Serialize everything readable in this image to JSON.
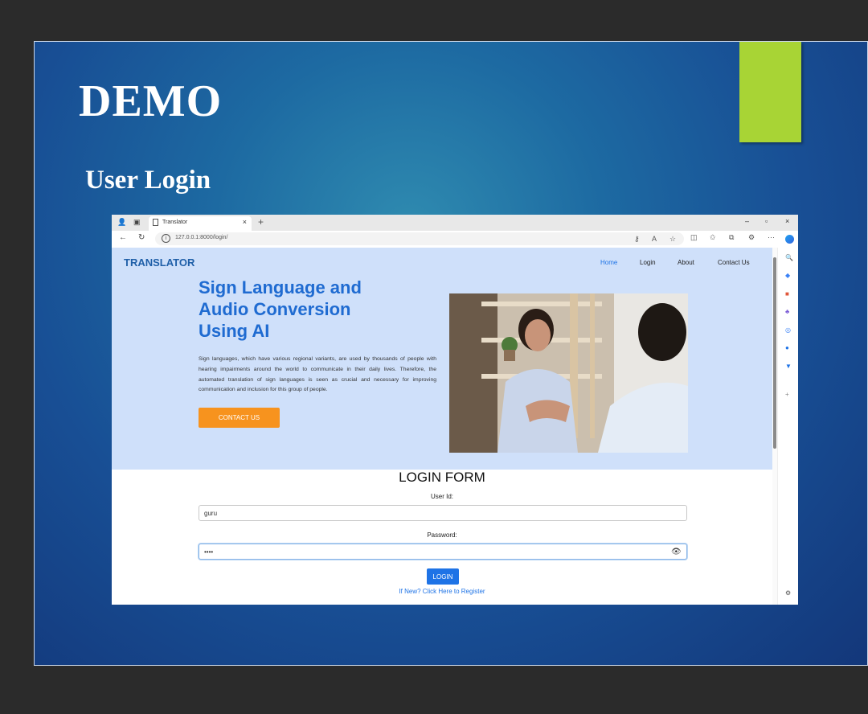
{
  "slide": {
    "title": "DEMO",
    "subtitle": "User Login",
    "accent_color": "#a8d435"
  },
  "browser": {
    "tab_title": "Translator",
    "tab_close": "×",
    "new_tab": "+",
    "url": "127.0.0.1:8000/login/",
    "window_controls": [
      "–",
      "▫",
      "×"
    ]
  },
  "site": {
    "brand": "TRANSLATOR",
    "nav": [
      "Home",
      "Login",
      "About",
      "Contact Us"
    ],
    "active_nav": "Home",
    "hero_heading": "Sign Language and Audio Conversion Using AI",
    "hero_text": "Sign languages, which have various regional variants, are used by thousands of people with hearing impairments around the world to communicate in their daily lives. Therefore, the automated translation of sign languages is seen as crucial and necessary for improving communication and inclusion for this group of people.",
    "contact_button": "CONTACT US",
    "colors": {
      "brand": "#1f5fa8",
      "hero_bg": "#cfe0fa",
      "cta": "#f7931e",
      "primary": "#1e73e6"
    }
  },
  "login": {
    "title": "LOGIN FORM",
    "userid_label": "User Id:",
    "userid_value": "guru",
    "password_label": "Password:",
    "password_value": "••••",
    "submit": "LOGIN",
    "register_link": "If New? Click Here to Register"
  },
  "icons": {
    "side_panel": [
      "search-icon",
      "tag-icon",
      "briefcase-icon",
      "people-icon",
      "recycle-icon",
      "outlook-icon",
      "shopping-icon",
      "add-icon",
      "settings-icon"
    ]
  }
}
